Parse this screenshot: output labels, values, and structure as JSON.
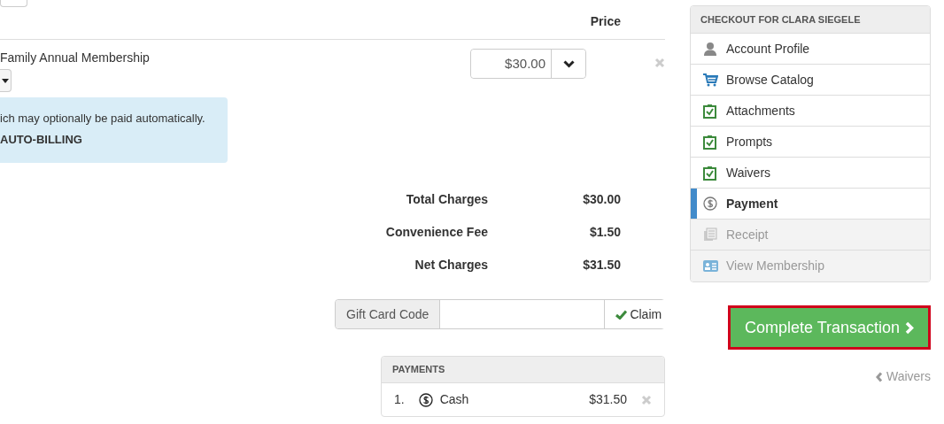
{
  "table": {
    "price_heading": "Price"
  },
  "line_items": [
    {
      "name": "Family Annual Membership",
      "price": "$30.00"
    }
  ],
  "info_notice": {
    "line_1": "ich may optionally be paid automatically.",
    "line_2": "AUTO-BILLING"
  },
  "totals": [
    {
      "label": "Total Charges",
      "value": "$30.00"
    },
    {
      "label": "Convenience Fee",
      "value": "$1.50"
    },
    {
      "label": "Net Charges",
      "value": "$31.50"
    }
  ],
  "gift_card": {
    "label": "Gift Card Code",
    "button": "Claim"
  },
  "payments": {
    "title": "PAYMENTS",
    "items": [
      {
        "number": "1.",
        "method": "Cash",
        "amount": "$31.50"
      }
    ]
  },
  "sidebar": {
    "title": "CHECKOUT FOR CLARA SIEGELE",
    "items": [
      {
        "label": "Account Profile",
        "kind": "person",
        "selected": false,
        "disabled": false
      },
      {
        "label": "Browse Catalog",
        "kind": "cart",
        "selected": false,
        "disabled": false
      },
      {
        "label": "Attachments",
        "kind": "clipboard",
        "selected": false,
        "disabled": false
      },
      {
        "label": "Prompts",
        "kind": "clipboard",
        "selected": false,
        "disabled": false
      },
      {
        "label": "Waivers",
        "kind": "clipboard",
        "selected": false,
        "disabled": false
      },
      {
        "label": "Payment",
        "kind": "dollar",
        "selected": true,
        "disabled": false
      },
      {
        "label": "Receipt",
        "kind": "receipt",
        "selected": false,
        "disabled": true
      },
      {
        "label": "View Membership",
        "kind": "card",
        "selected": false,
        "disabled": true
      }
    ]
  },
  "complete_button": "Complete Transaction",
  "back_link": "Waivers"
}
